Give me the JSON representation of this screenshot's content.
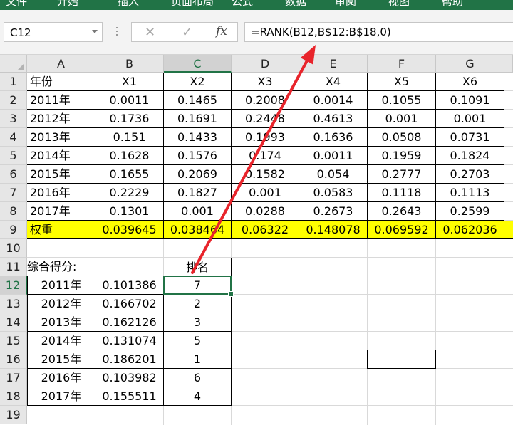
{
  "ribbon_tabs": [
    "文件",
    "开始",
    "插入",
    "页面布局",
    "公式",
    "数据",
    "审阅",
    "视图",
    "帮助"
  ],
  "name_box": {
    "value": "C12"
  },
  "formula_bar": {
    "cancel_glyph": "✕",
    "enter_glyph": "✓",
    "fx_label": "fx",
    "formula": "=RANK(B12,B$12:B$18,0)"
  },
  "columns": [
    "A",
    "B",
    "C",
    "D",
    "E",
    "F",
    "G"
  ],
  "selected_column": "C",
  "rows": [
    "1",
    "2",
    "3",
    "4",
    "5",
    "6",
    "7",
    "8",
    "9",
    "10",
    "11",
    "12",
    "13",
    "14",
    "15",
    "16",
    "17",
    "18",
    "19"
  ],
  "selected_row": "12",
  "table1": {
    "header": [
      "年份",
      "X1",
      "X2",
      "X3",
      "X4",
      "X5",
      "X6"
    ],
    "rows": [
      [
        "2011年",
        "0.0011",
        "0.1465",
        "0.2008",
        "0.0014",
        "0.1055",
        "0.1091"
      ],
      [
        "2012年",
        "0.1736",
        "0.1691",
        "0.2448",
        "0.4613",
        "0.001",
        "0.001"
      ],
      [
        "2013年",
        "0.151",
        "0.1433",
        "0.1993",
        "0.1636",
        "0.0508",
        "0.0731"
      ],
      [
        "2014年",
        "0.1628",
        "0.1576",
        "0.174",
        "0.0011",
        "0.1959",
        "0.1824"
      ],
      [
        "2015年",
        "0.1655",
        "0.2069",
        "0.1582",
        "0.054",
        "0.2777",
        "0.2703"
      ],
      [
        "2016年",
        "0.2229",
        "0.1827",
        "0.001",
        "0.0583",
        "0.1118",
        "0.1113"
      ],
      [
        "2017年",
        "0.1301",
        "0.001",
        "0.0288",
        "0.2673",
        "0.2643",
        "0.2599"
      ]
    ],
    "weights": [
      "权重",
      "0.039645",
      "0.038464",
      "0.06322",
      "0.148078",
      "0.069592",
      "0.062036"
    ]
  },
  "table2": {
    "label": "综合得分:",
    "rank_header": "排名",
    "rows": [
      [
        "2011年",
        "0.101386",
        "7"
      ],
      [
        "2012年",
        "0.166702",
        "2"
      ],
      [
        "2013年",
        "0.162126",
        "3"
      ],
      [
        "2014年",
        "0.131074",
        "5"
      ],
      [
        "2015年",
        "0.186201",
        "1"
      ],
      [
        "2016年",
        "0.103982",
        "6"
      ],
      [
        "2017年",
        "0.155511",
        "4"
      ]
    ]
  },
  "colors": {
    "ribbon": "#217346",
    "highlight": "#ffff00",
    "arrow": "#e8242b",
    "selection": "#217346"
  }
}
